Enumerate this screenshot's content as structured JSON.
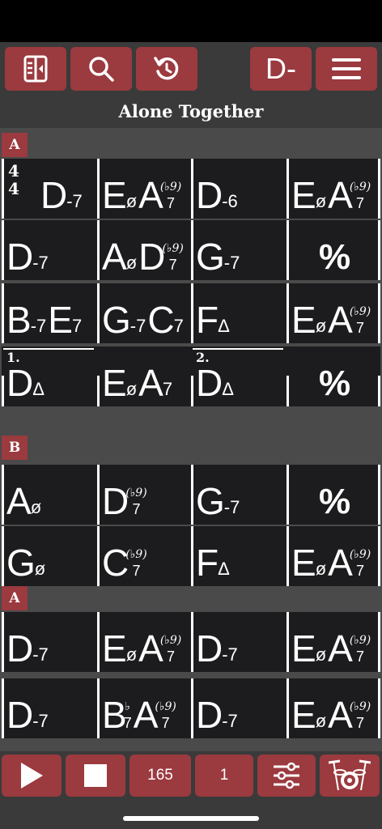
{
  "toolbar": {
    "layout_icon": "sidebar-layout-icon",
    "search_icon": "search-icon",
    "undo_icon": "undo-icon",
    "key_label": "D-",
    "menu_icon": "hamburger-menu-icon"
  },
  "song": {
    "title": "Alone Together"
  },
  "sheet": {
    "time_signature": {
      "top": "4",
      "bottom": "4"
    },
    "sections": [
      "A",
      "B",
      "A"
    ],
    "rows": [
      {
        "bars": [
          {
            "chords": [
              {
                "root": "D",
                "qual": "-7"
              }
            ]
          },
          {
            "chords": [
              {
                "root": "E",
                "qual": "ø"
              },
              {
                "root": "A",
                "sup": "(♭9)",
                "sub": "7"
              }
            ]
          },
          {
            "chords": [
              {
                "root": "D",
                "qual": "-6"
              }
            ]
          },
          {
            "chords": [
              {
                "root": "E",
                "qual": "ø"
              },
              {
                "root": "A",
                "sup": "(♭9)",
                "sub": "7"
              }
            ]
          }
        ]
      },
      {
        "bars": [
          {
            "chords": [
              {
                "root": "D",
                "qual": "-7"
              }
            ]
          },
          {
            "chords": [
              {
                "root": "A",
                "qual": "ø"
              },
              {
                "root": "D",
                "sup": "(♭9)",
                "sub": "7"
              }
            ]
          },
          {
            "chords": [
              {
                "root": "G",
                "qual": "-7"
              }
            ]
          },
          {
            "chords": [
              {
                "symbol": "%"
              }
            ]
          }
        ]
      },
      {
        "bars": [
          {
            "chords": [
              {
                "root": "B",
                "qual": "-7"
              },
              {
                "root": "E",
                "qual": "7"
              }
            ]
          },
          {
            "chords": [
              {
                "root": "G",
                "qual": "-7"
              },
              {
                "root": "C",
                "qual": "7"
              }
            ]
          },
          {
            "chords": [
              {
                "root": "F",
                "qual": "Δ"
              }
            ]
          },
          {
            "chords": [
              {
                "root": "E",
                "qual": "ø"
              },
              {
                "root": "A",
                "sup": "(♭9)",
                "sub": "7"
              }
            ]
          }
        ]
      },
      {
        "endings": [
          "1.",
          "2."
        ],
        "bars": [
          {
            "chords": [
              {
                "root": "D",
                "qual": "Δ"
              }
            ]
          },
          {
            "chords": [
              {
                "root": "E",
                "qual": "ø"
              },
              {
                "root": "A",
                "qual": "7"
              }
            ]
          },
          {
            "chords": [
              {
                "root": "D",
                "qual": "Δ"
              }
            ]
          },
          {
            "chords": [
              {
                "symbol": "%"
              }
            ]
          }
        ]
      },
      {
        "bars": [
          {
            "chords": [
              {
                "root": "A",
                "qual": "ø"
              }
            ]
          },
          {
            "chords": [
              {
                "root": "D",
                "sup": "(♭9)",
                "sub": "7"
              }
            ]
          },
          {
            "chords": [
              {
                "root": "G",
                "qual": "-7"
              }
            ]
          },
          {
            "chords": [
              {
                "symbol": "%"
              }
            ]
          }
        ]
      },
      {
        "bars": [
          {
            "chords": [
              {
                "root": "G",
                "qual": "ø"
              }
            ]
          },
          {
            "chords": [
              {
                "root": "C",
                "sup": "(♭9)",
                "sub": "7"
              }
            ]
          },
          {
            "chords": [
              {
                "root": "F",
                "qual": "Δ"
              }
            ]
          },
          {
            "chords": [
              {
                "root": "E",
                "qual": "ø"
              },
              {
                "root": "A",
                "sup": "(♭9)",
                "sub": "7"
              }
            ]
          }
        ]
      },
      {
        "bars": [
          {
            "chords": [
              {
                "root": "D",
                "qual": "-7"
              }
            ]
          },
          {
            "chords": [
              {
                "root": "E",
                "qual": "ø"
              },
              {
                "root": "A",
                "sup": "(♭9)",
                "sub": "7"
              }
            ]
          },
          {
            "chords": [
              {
                "root": "D",
                "qual": "-7"
              }
            ]
          },
          {
            "chords": [
              {
                "root": "E",
                "qual": "ø"
              },
              {
                "root": "A",
                "sup": "(♭9)",
                "sub": "7"
              }
            ]
          }
        ]
      },
      {
        "bars": [
          {
            "chords": [
              {
                "root": "D",
                "qual": "-7"
              }
            ]
          },
          {
            "chords": [
              {
                "root": "B",
                "sup": "♭",
                "sub": "7"
              },
              {
                "root": "A",
                "sup": "(♭9)",
                "sub": "7"
              }
            ]
          },
          {
            "chords": [
              {
                "root": "D",
                "qual": "-7"
              }
            ]
          },
          {
            "chords": [
              {
                "root": "E",
                "qual": "ø"
              },
              {
                "root": "A",
                "sup": "(♭9)",
                "sub": "7"
              }
            ]
          }
        ]
      }
    ]
  },
  "transport": {
    "play_icon": "play-icon",
    "stop_icon": "stop-icon",
    "tempo": "165",
    "repeats": "1",
    "mixer_icon": "mixer-sliders-icon",
    "drums_icon": "drum-kit-icon"
  },
  "colors": {
    "accent": "#9b3a3f",
    "bar_bg": "#3a3a3a",
    "sheet_bg": "#1c1c1e"
  }
}
